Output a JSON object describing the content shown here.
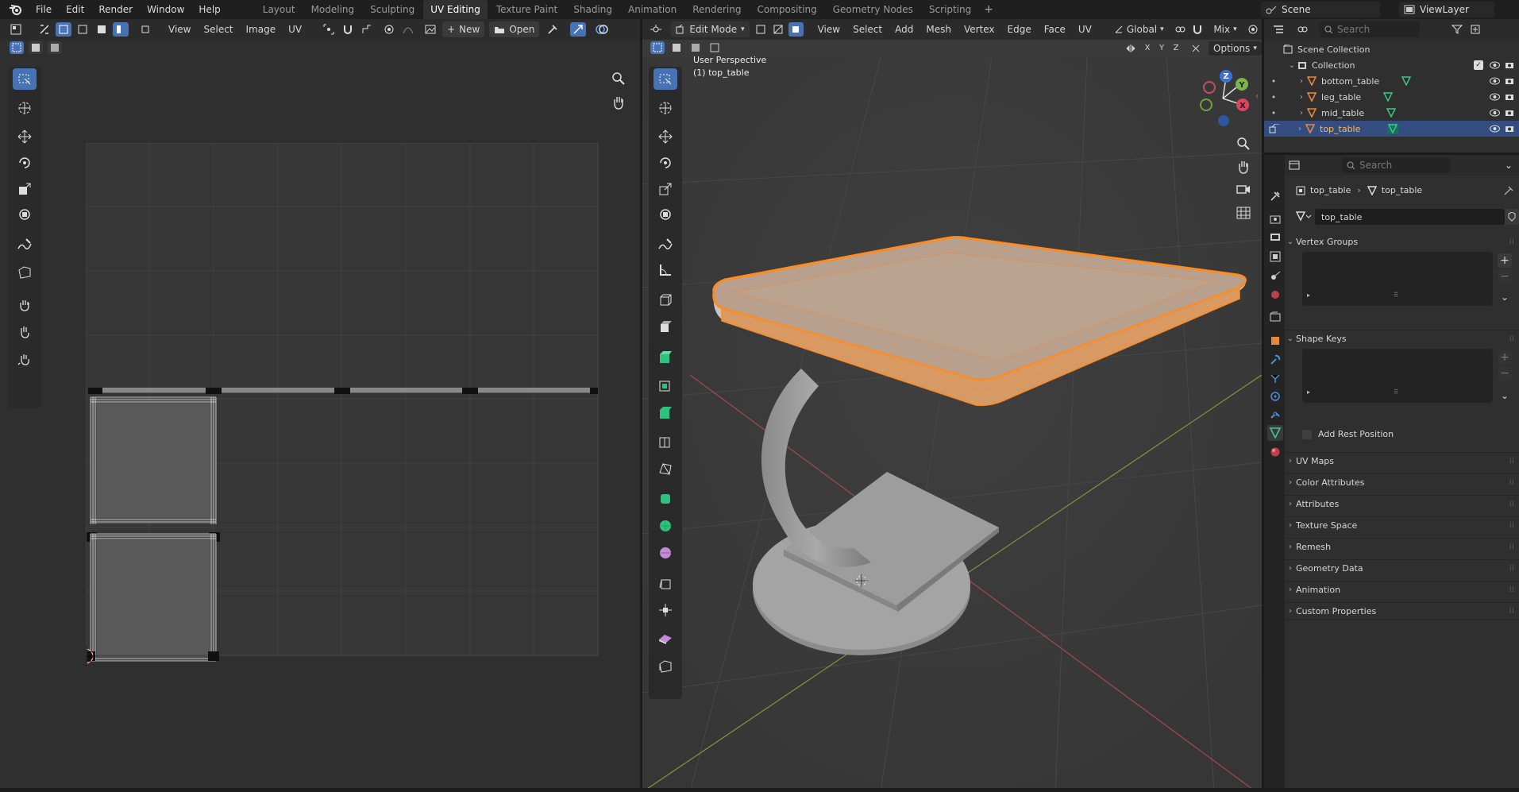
{
  "topbar": {
    "menus": [
      "File",
      "Edit",
      "Render",
      "Window",
      "Help"
    ],
    "workspaces": [
      "Layout",
      "Modeling",
      "Sculpting",
      "UV Editing",
      "Texture Paint",
      "Shading",
      "Animation",
      "Rendering",
      "Compositing",
      "Geometry Nodes",
      "Scripting"
    ],
    "active_workspace": "UV Editing",
    "scene_label": "Scene",
    "viewlayer_label": "ViewLayer"
  },
  "uv_editor": {
    "menus": [
      "View",
      "Select",
      "Image",
      "UV"
    ],
    "new_label": "New",
    "open_label": "Open"
  },
  "viewport": {
    "mode_label": "Edit Mode",
    "menus": [
      "View",
      "Select",
      "Add",
      "Mesh",
      "Vertex",
      "Edge",
      "Face",
      "UV"
    ],
    "orientation_label": "Global",
    "shading_label": "Mix",
    "options_label": "Options",
    "axis_labels": [
      "X",
      "Y",
      "Z"
    ],
    "overlay_title": "User Perspective",
    "overlay_object": "(1) top_table",
    "gizmo_axes": [
      "X",
      "Y",
      "Z"
    ]
  },
  "outliner": {
    "search_placeholder": "Search",
    "scene_collection": "Scene Collection",
    "collection": "Collection",
    "objects": [
      "bottom_table",
      "leg_table",
      "mid_table",
      "top_table"
    ],
    "selected_object": "top_table"
  },
  "properties": {
    "search_placeholder": "Search",
    "breadcrumb_object": "top_table",
    "breadcrumb_data": "top_table",
    "mesh_name": "top_table",
    "sections_open": [
      "Vertex Groups",
      "Shape Keys"
    ],
    "add_rest_position": "Add Rest Position",
    "sections_closed": [
      "UV Maps",
      "Color Attributes",
      "Attributes",
      "Texture Space",
      "Remesh",
      "Geometry Data",
      "Animation",
      "Custom Properties"
    ]
  },
  "colors": {
    "accent": "#4772b3",
    "selection_orange": "#ff8a1e",
    "outliner_selected": "#334d80",
    "mesh_icon_green": "#3ec98a",
    "object_icon_orange": "#e8883a"
  }
}
